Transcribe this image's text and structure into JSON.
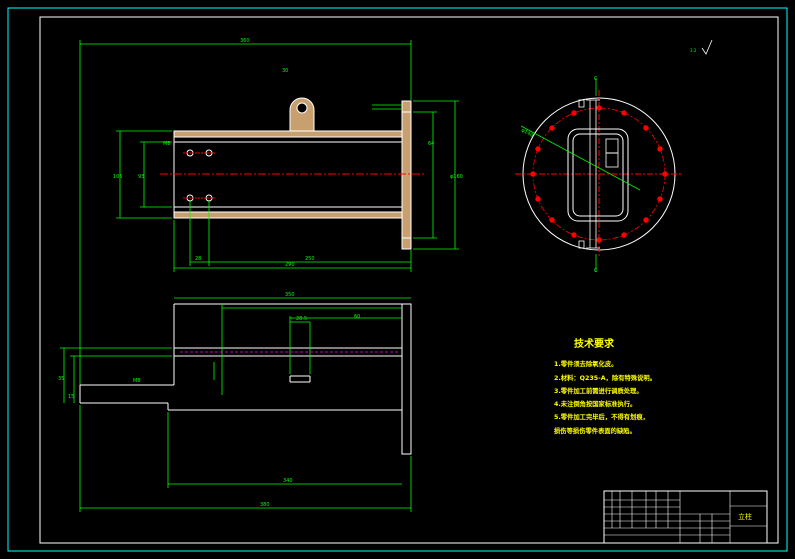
{
  "tech_requirements": {
    "title": "技术要求",
    "items": [
      "1.零件须去除氧化皮。",
      "2.材料：Q235-A，除有特殊说明。",
      "3.零件加工前需进行调质处理。",
      "4.未注倒角按国家标准执行。",
      "5.零件加工完毕后，不得有划痕，",
      "损伤等损伤零件表面的缺陷。"
    ]
  },
  "title_block": {
    "label_right": "立柱"
  },
  "colors": {
    "background": "#000000",
    "outline": "#ffffff",
    "dimension": "#00ff00",
    "centerline": "#ff0000",
    "section_fill": "#c8a070",
    "text_yellow": "#ffff00",
    "frame_cyan": "#00ffff",
    "hidden_line": "#ff00ff"
  }
}
